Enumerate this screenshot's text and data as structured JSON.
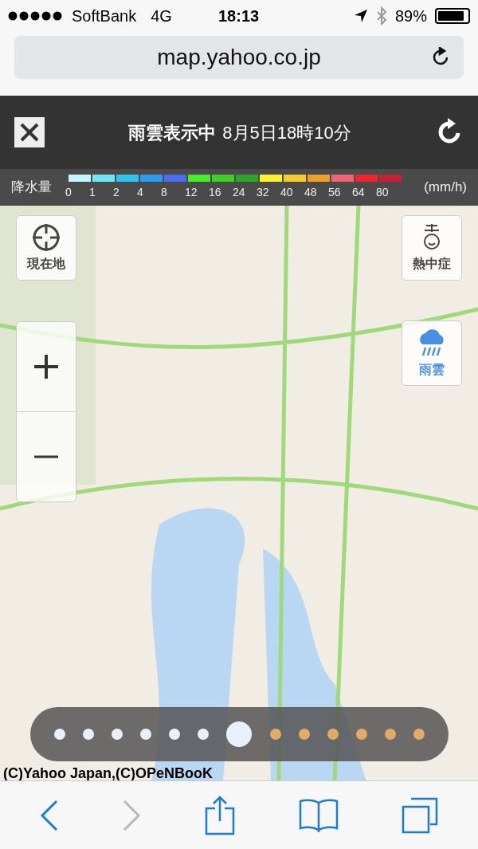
{
  "status_bar": {
    "carrier": "SoftBank",
    "network": "4G",
    "time": "18:13",
    "battery": "89%"
  },
  "address_bar": {
    "url": "map.yahoo.co.jp"
  },
  "header": {
    "title": "雨雲表示中",
    "datetime": "8月5日18時10分"
  },
  "legend": {
    "label": "降水量",
    "unit": "(mm/h)",
    "steps": [
      {
        "value": "0",
        "color": "#c6f6fb"
      },
      {
        "value": "1",
        "color": "#6ee6f5"
      },
      {
        "value": "2",
        "color": "#2ec5f0"
      },
      {
        "value": "4",
        "color": "#2b9cee"
      },
      {
        "value": "8",
        "color": "#4f6cf0"
      },
      {
        "value": "12",
        "color": "#42ef2a"
      },
      {
        "value": "16",
        "color": "#3fcf25"
      },
      {
        "value": "24",
        "color": "#2fa52a"
      },
      {
        "value": "32",
        "color": "#fbf32b"
      },
      {
        "value": "40",
        "color": "#f2cd2d"
      },
      {
        "value": "48",
        "color": "#efa127"
      },
      {
        "value": "56",
        "color": "#f06478"
      },
      {
        "value": "64",
        "color": "#f0242a"
      },
      {
        "value": "80",
        "color": "#c3203a"
      }
    ]
  },
  "map_buttons": [
    {
      "kind": "locate",
      "label": "現在地",
      "selected": false
    },
    {
      "kind": "heat",
      "label": "熱中症",
      "selected": false
    },
    {
      "kind": "rain",
      "label": "雨雲",
      "selected": true
    }
  ],
  "timeline": [
    {
      "kind": "past",
      "selected": false
    },
    {
      "kind": "past",
      "selected": false
    },
    {
      "kind": "past",
      "selected": false
    },
    {
      "kind": "past",
      "selected": false
    },
    {
      "kind": "past",
      "selected": false
    },
    {
      "kind": "past",
      "selected": false
    },
    {
      "kind": "past",
      "selected": true
    },
    {
      "kind": "forecast",
      "selected": false
    },
    {
      "kind": "forecast",
      "selected": false
    },
    {
      "kind": "forecast",
      "selected": false
    },
    {
      "kind": "forecast",
      "selected": false
    },
    {
      "kind": "forecast",
      "selected": false
    },
    {
      "kind": "forecast",
      "selected": false
    }
  ],
  "copyright": "(C)Yahoo Japan,(C)OPeNBooK",
  "toolbar": [
    {
      "kind": "back",
      "disabled": false
    },
    {
      "kind": "forward",
      "disabled": true
    },
    {
      "kind": "share",
      "disabled": false
    },
    {
      "kind": "bookmarks",
      "disabled": false
    },
    {
      "kind": "tabs",
      "disabled": false
    }
  ]
}
